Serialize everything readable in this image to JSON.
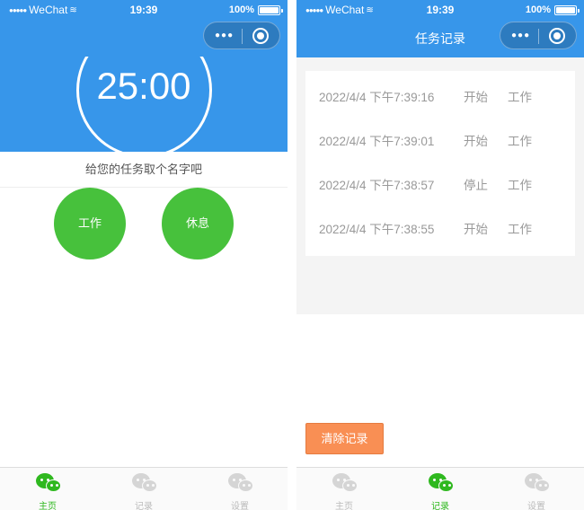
{
  "status_bar": {
    "carrier": "WeChat",
    "time": "19:39",
    "battery": "100%"
  },
  "home": {
    "timer": "25:00",
    "task_prompt": "给您的任务取个名字吧",
    "work_button": "工作",
    "rest_button": "休息"
  },
  "records": {
    "title": "任务记录",
    "items": [
      {
        "time": "2022/4/4 下午7:39:16",
        "action": "开始",
        "type": "工作"
      },
      {
        "time": "2022/4/4 下午7:39:01",
        "action": "开始",
        "type": "工作"
      },
      {
        "time": "2022/4/4 下午7:38:57",
        "action": "停止",
        "type": "工作"
      },
      {
        "time": "2022/4/4 下午7:38:55",
        "action": "开始",
        "type": "工作"
      }
    ],
    "clear_button": "清除记录"
  },
  "tabs": [
    {
      "label": "主页",
      "icon": "wechat-icon"
    },
    {
      "label": "记录",
      "icon": "wechat-icon"
    },
    {
      "label": "设置",
      "icon": "wechat-icon"
    }
  ],
  "colors": {
    "primary": "#3796ea",
    "green": "#47c13c",
    "tab_active": "#2fb81f",
    "clear_button": "#f98f54"
  }
}
